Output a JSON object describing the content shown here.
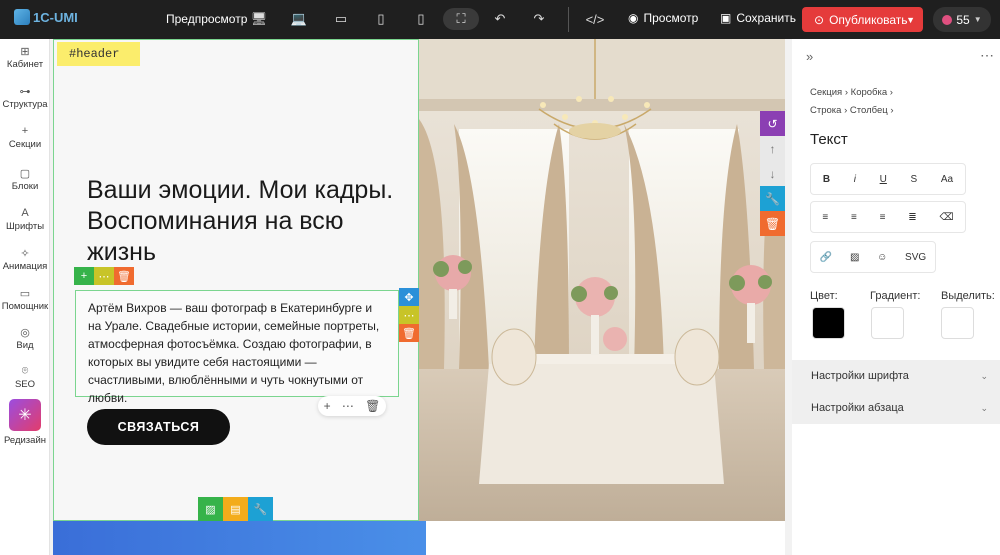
{
  "app": {
    "logo": "1C-UMI"
  },
  "toolbar": {
    "preview_label": "Предпросмотр",
    "view_label": "Просмотр",
    "save_label": "Сохранить",
    "publish_label": "Опубликовать",
    "counter": "55"
  },
  "sidebar": {
    "items": [
      {
        "label": "Кабинет",
        "icon": "cabinet-icon",
        "glyph": "⊞"
      },
      {
        "label": "Структура",
        "icon": "structure-icon",
        "glyph": "⊶"
      },
      {
        "label": "Секции",
        "icon": "plus-icon",
        "glyph": "+"
      },
      {
        "label": "Блоки",
        "icon": "blocks-icon",
        "glyph": "▢"
      },
      {
        "label": "Шрифты",
        "icon": "fonts-icon",
        "glyph": "A"
      },
      {
        "label": "Анимация",
        "icon": "animation-icon",
        "glyph": "✧"
      },
      {
        "label": "Помощник",
        "icon": "chat-icon",
        "glyph": "▭"
      },
      {
        "label": "Вид",
        "icon": "view-icon",
        "glyph": "◎"
      },
      {
        "label": "SEO",
        "icon": "seo-icon",
        "glyph": "⌾"
      }
    ],
    "redesign_label": "Редизайн"
  },
  "canvas": {
    "section_tag": "#header",
    "heading": "Ваши эмоции. Мои кадры. Воспоминания на всю жизнь",
    "paragraph": "Артём Вихров — ваш фотограф в Екатеринбурге и на Урале. Свадебные истории, семейные портреты, атмосферная фотосъёмка. Создаю фотографии, в которых вы увидите себя настоящими — счастливыми, влюблёнными и чуть чокнутыми от любви.",
    "cta_label": "СВЯЗАТЬСЯ"
  },
  "panel": {
    "crumbs_row1": [
      "Секция",
      "Коробка"
    ],
    "crumbs_row2": [
      "Строка",
      "Столбец"
    ],
    "title": "Текст",
    "format_buttons": [
      "B",
      "i",
      "U",
      "S",
      "Aa"
    ],
    "color_labels": {
      "color": "Цвет:",
      "gradient": "Градиент:",
      "highlight": "Выделить:"
    },
    "colors": {
      "color": "#000000",
      "gradient": "#ffffff",
      "highlight": "#ffffff"
    },
    "font_settings": "Настройки шрифта",
    "paragraph_settings": "Настройки абзаца"
  },
  "colors": {
    "accent_red": "#e53b3b",
    "section_tag": "#fbed6c",
    "selection_green": "#7bd58f"
  }
}
